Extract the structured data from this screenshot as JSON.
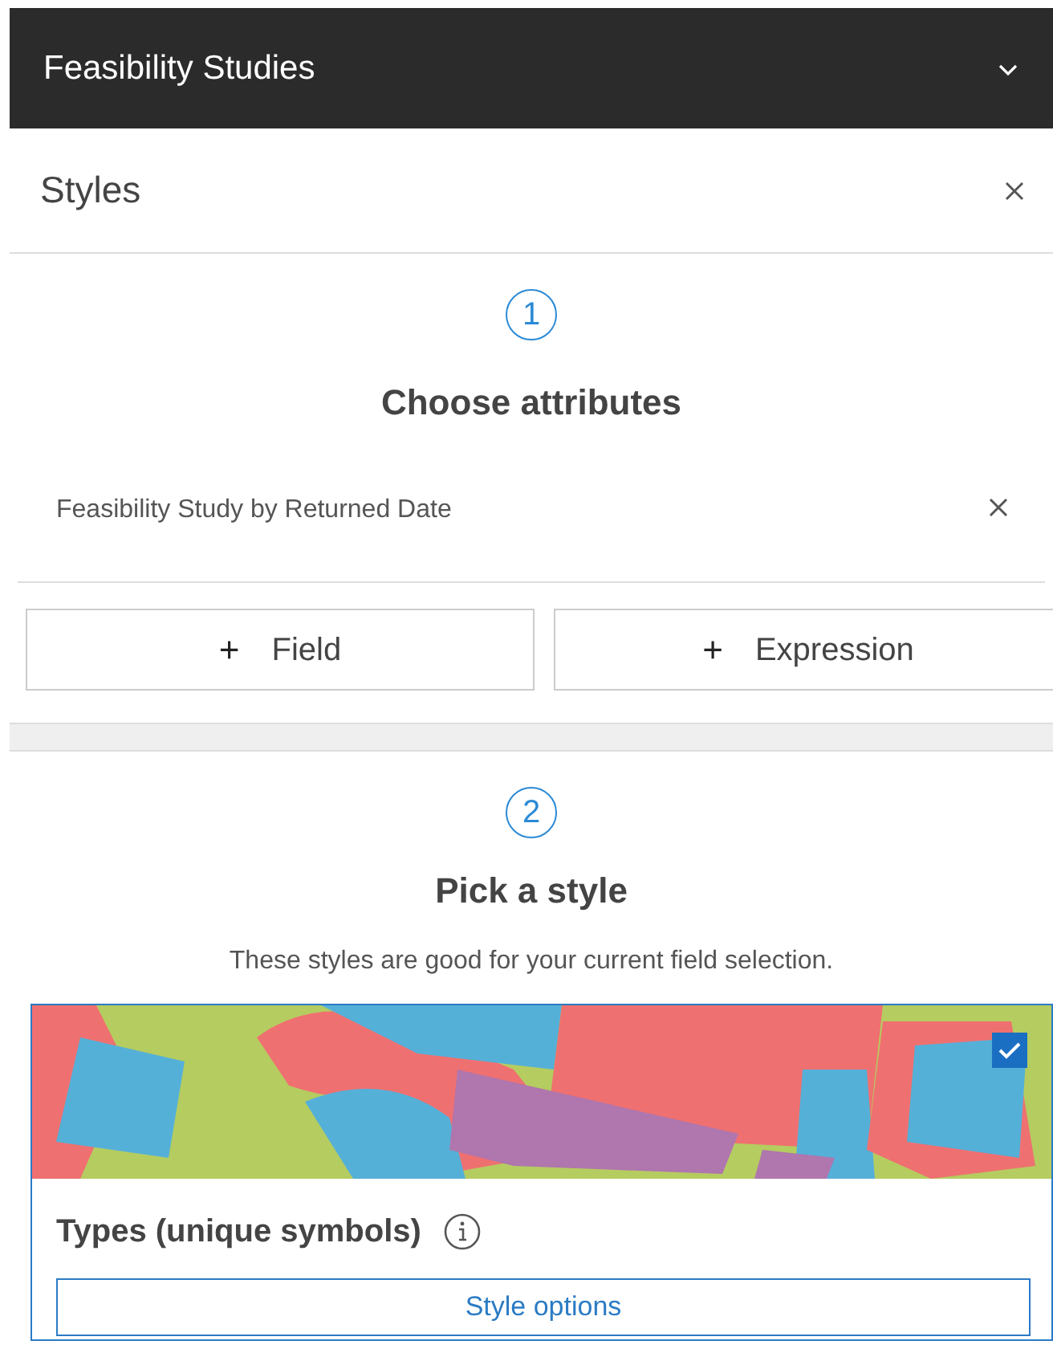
{
  "header": {
    "title": "Feasibility Studies",
    "expanded": false
  },
  "panel": {
    "title": "Styles"
  },
  "step_1": {
    "number": "1",
    "title": "Choose attributes",
    "attributes": [
      {
        "label": "Feasibility Study by Returned Date"
      }
    ],
    "buttons": [
      {
        "icon": "+",
        "label": "Field"
      },
      {
        "icon": "+",
        "label": "Expression"
      }
    ]
  },
  "step_2": {
    "number": "2",
    "title": "Pick a style",
    "description": "These styles are good for your current field selection.",
    "styles": [
      {
        "kind": "picture",
        "title": "Types (unique symbols)",
        "selected": true,
        "button": "Style options"
      }
    ]
  }
}
